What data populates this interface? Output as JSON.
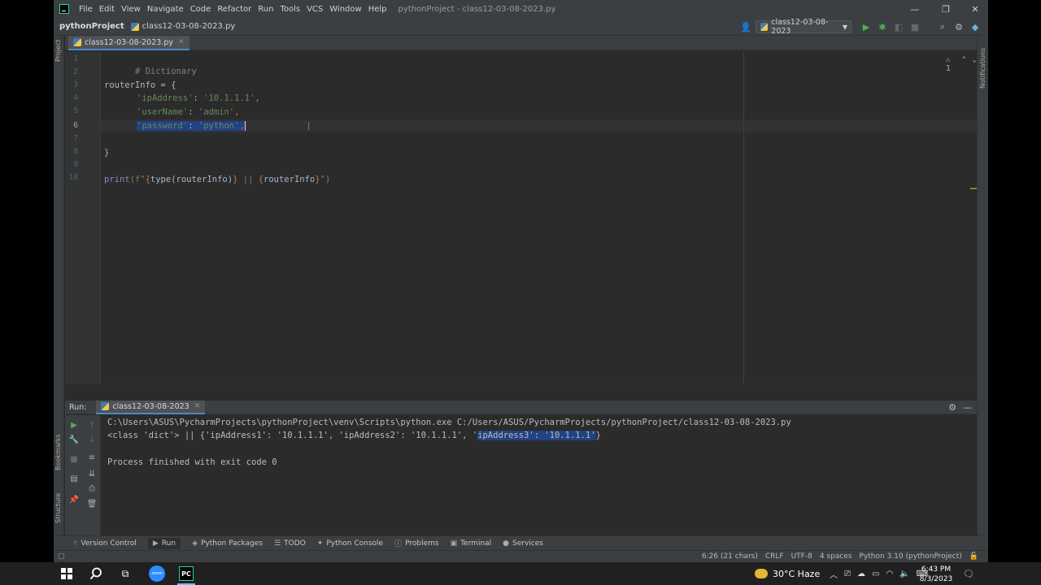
{
  "menu": [
    "File",
    "Edit",
    "View",
    "Navigate",
    "Code",
    "Refactor",
    "Run",
    "Tools",
    "VCS",
    "Window",
    "Help"
  ],
  "window_title": "pythonProject - class12-03-08-2023.py",
  "nav": {
    "project": "pythonProject",
    "file": "class12-03-08-2023.py",
    "run_config": "class12-03-08-2023"
  },
  "left_stripe": {
    "project": "Project",
    "bookmarks": "Bookmarks",
    "structure": "Structure"
  },
  "right_stripe": {
    "notifications": "Notifications"
  },
  "editor": {
    "tab_label": "class12-03-08-2023.py",
    "warnings": "1",
    "line_numbers": [
      "1",
      "2",
      "3",
      "4",
      "5",
      "6",
      "7",
      "8",
      "9",
      "10"
    ],
    "line1": "# Dictionary",
    "line3_a": "routerInfo = ",
    "line3_b": "{",
    "l4_key": "'ipAddress'",
    "l4_sep": ": ",
    "l4_val": "'10.1.1.1'",
    "l4_comma": ",",
    "l5_key": "'userName'",
    "l5_sep": ": ",
    "l5_val": "'admin'",
    "l5_comma": ",",
    "l6_key": "'password'",
    "l6_sep": ": ",
    "l6_val": "'python'",
    "l6_comma": ",",
    "line8": "}",
    "l10_print": "print",
    "l10_open": "(f\"",
    "l10_b1": "{",
    "l10_mid1": "type(routerInfo)",
    "l10_b2": "}",
    "l10_sep": " || ",
    "l10_b3": "{",
    "l10_mid2": "routerInfo",
    "l10_b4": "}",
    "l10_close": "\")"
  },
  "run": {
    "label": "Run:",
    "tab": "class12-03-08-2023",
    "cmd": "C:\\Users\\ASUS\\PycharmProjects\\pythonProject\\venv\\Scripts\\python.exe C:/Users/ASUS/PycharmProjects/pythonProject/class12-03-08-2023.py",
    "out_a": "<class 'dict'> || {'ipAddress1': '10.1.1.1', 'ipAddress2': '10.1.1.1', '",
    "out_sel": "ipAddress3': '10.1.1.1'",
    "out_b": "}",
    "exit": "Process finished with exit code 0"
  },
  "tool_tabs": [
    "Version Control",
    "Run",
    "Python Packages",
    "TODO",
    "Python Console",
    "Problems",
    "Terminal",
    "Services"
  ],
  "status": {
    "position": "6:26 (21 chars)",
    "line_sep": "CRLF",
    "encoding": "UTF-8",
    "indent": "4 spaces",
    "interpreter": "Python 3.10 (pythonProject)"
  },
  "taskbar": {
    "zoom_label": "zoom",
    "pycharm_label": "PC",
    "weather": "30°C  Haze",
    "time": "6:43 PM",
    "date": "8/3/2023"
  },
  "colors": {
    "editor_bg": "#2b2b2b",
    "panel_bg": "#3c3f41",
    "selection": "#214283",
    "string": "#6a8759",
    "keyword": "#cc7832",
    "builtin": "#8888c6",
    "comment": "#808080"
  }
}
